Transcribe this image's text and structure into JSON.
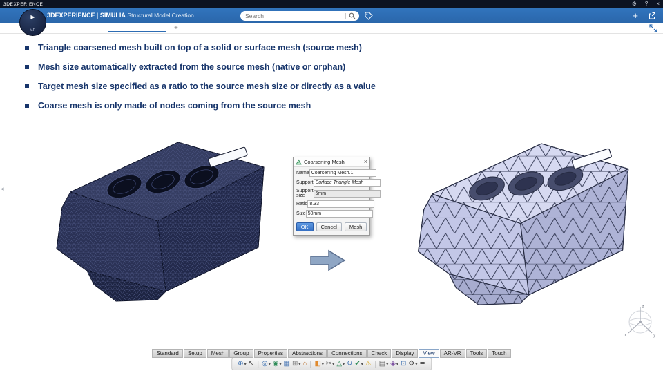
{
  "titlebar": {
    "title": "3DEXPERIENCE",
    "icons": [
      {
        "name": "gear-icon",
        "glyph": "⚙"
      },
      {
        "name": "help-icon",
        "glyph": "?"
      },
      {
        "name": "close-icon",
        "glyph": "×"
      }
    ]
  },
  "header": {
    "product": "3DEXPERIENCE",
    "separator": "|",
    "brand": "SIMULIA",
    "app_name": "Structural Model Creation",
    "search_placeholder": "Search"
  },
  "compass": {
    "label": "V.R",
    "play_glyph": "▶"
  },
  "tabstrip": {
    "new_tab_glyph": "+"
  },
  "edge_collapse_glyph": "◂",
  "bullets": [
    "Triangle coarsened mesh built on top of a solid or surface mesh (source mesh)",
    "Mesh size automatically extracted from the source mesh (native or orphan)",
    "Target mesh size specified as a ratio to the source mesh size or directly as a value",
    "Coarse mesh is only made of nodes coming from the source mesh"
  ],
  "dialog": {
    "title": "Coarsening Mesh",
    "close_glyph": "×",
    "fields": [
      {
        "label": "Name",
        "value": "Coarsening Mesh.1"
      },
      {
        "label": "Support",
        "value": "Surface Triangle Mesh"
      },
      {
        "label": "Support size",
        "value": "6mm"
      },
      {
        "label": "Ratio",
        "value": "8.33"
      },
      {
        "label": "Size",
        "value": "50mm"
      }
    ],
    "buttons": [
      {
        "label": "OK"
      },
      {
        "label": "Cancel"
      },
      {
        "label": "Mesh"
      }
    ]
  },
  "ribbon": {
    "tabs": [
      "Standard",
      "Setup",
      "Mesh",
      "Group",
      "Properties",
      "Abstractions",
      "Connections",
      "Check",
      "Display",
      "View",
      "AR-VR",
      "Tools",
      "Touch"
    ],
    "active": "View"
  },
  "toolbar": {
    "items": [
      {
        "name": "zoom-tool-icon",
        "glyph": "⊕",
        "color": "#3a6fb0",
        "dd": true
      },
      {
        "name": "select-cursor-icon",
        "glyph": "↖",
        "color": "#555555",
        "dd": false
      },
      {
        "sep": true
      },
      {
        "name": "center-view-icon",
        "glyph": "◎",
        "color": "#3a6fb0",
        "dd": true
      },
      {
        "name": "explore-globe-icon",
        "glyph": "◉",
        "color": "#2e8b57",
        "dd": true
      },
      {
        "name": "multi-view-icon",
        "glyph": "▦",
        "color": "#4a77b5",
        "dd": false
      },
      {
        "name": "view-layout-icon",
        "glyph": "⊞",
        "color": "#777777",
        "dd": true
      },
      {
        "name": "home-view-icon",
        "glyph": "⌂",
        "color": "#b5651d",
        "dd": false
      },
      {
        "sep": true
      },
      {
        "name": "render-style-icon",
        "glyph": "◧",
        "color": "#e08a2d",
        "dd": true
      },
      {
        "name": "section-cut-icon",
        "glyph": "✂",
        "color": "#666666",
        "dd": true
      },
      {
        "name": "measure-icon",
        "glyph": "△",
        "color": "#2e8b57",
        "dd": true
      },
      {
        "name": "update-mesh-icon",
        "glyph": "↻",
        "color": "#3a6fb0",
        "dd": false
      },
      {
        "name": "check-quality-icon",
        "glyph": "✔",
        "color": "#2e8b57",
        "dd": true
      },
      {
        "name": "warnings-icon",
        "glyph": "⚠",
        "color": "#d9a620",
        "dd": false
      },
      {
        "sep": true
      },
      {
        "name": "layers-icon",
        "glyph": "▤",
        "color": "#555555",
        "dd": true
      },
      {
        "name": "materials-icon",
        "glyph": "◈",
        "color": "#7a4ea0",
        "dd": true
      },
      {
        "name": "capture-icon",
        "glyph": "⊡",
        "color": "#3a6fb0",
        "dd": false
      },
      {
        "name": "settings-gear-icon",
        "glyph": "⚙",
        "color": "#555555",
        "dd": true
      },
      {
        "name": "options-list-icon",
        "glyph": "≣",
        "color": "#555555",
        "dd": false
      }
    ]
  },
  "axis": {
    "x": "x",
    "y": "y",
    "z": "z"
  },
  "colors": {
    "header_blue": "#2d6cb3",
    "slide_text": "#17356b",
    "source_mesh": "#2a3152",
    "coarse_mesh": "#c2c6e6",
    "ok_button": "#3570c4"
  }
}
